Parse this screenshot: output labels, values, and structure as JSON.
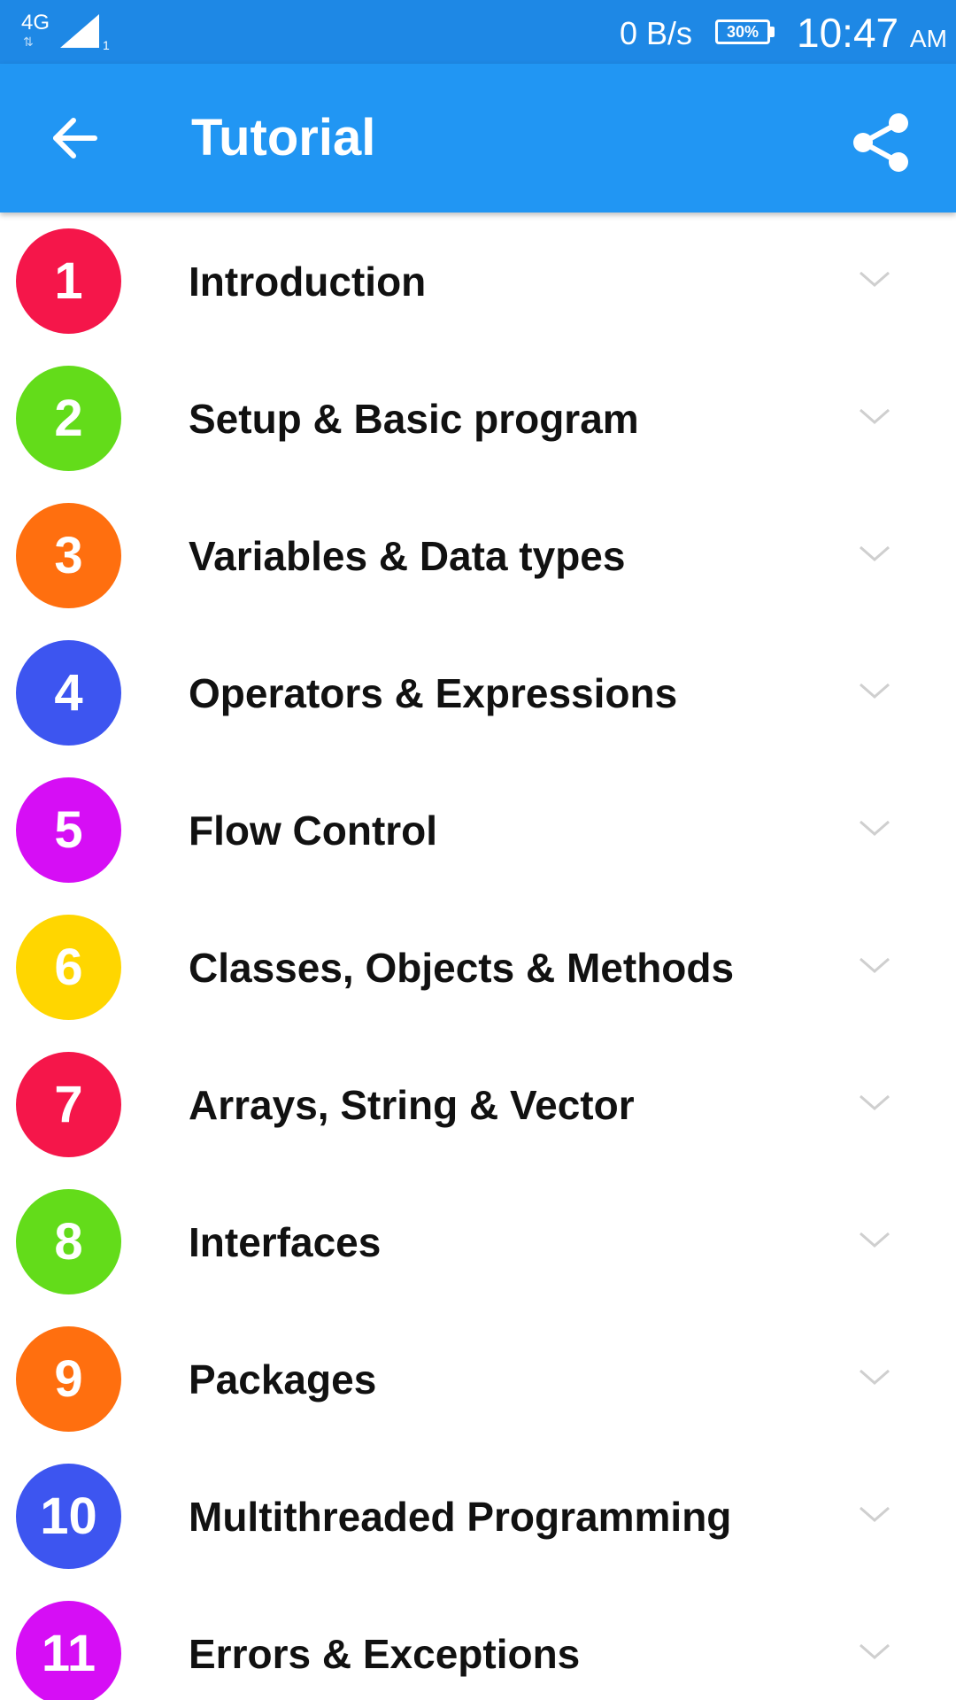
{
  "status_bar": {
    "network": "4G",
    "network_arrows": "⇅",
    "sim": "1",
    "speed": "0 B/s",
    "battery": "30%",
    "time": "10:47",
    "ampm": "AM"
  },
  "app_bar": {
    "title": "Tutorial",
    "back_icon": "arrow-back-icon",
    "share_icon": "share-icon"
  },
  "colors": {
    "status_bar": "#1e88e5",
    "app_bar": "#2196f3",
    "red": "#f5164a",
    "green": "#63dc1a",
    "orange": "#ff6f0f",
    "blue": "#3d55f0",
    "magenta": "#d60ef5",
    "yellow": "#ffd600"
  },
  "items": [
    {
      "number": "1",
      "label": "Introduction",
      "color": "#f5164a"
    },
    {
      "number": "2",
      "label": "Setup & Basic program",
      "color": "#63dc1a"
    },
    {
      "number": "3",
      "label": "Variables & Data types",
      "color": "#ff6f0f"
    },
    {
      "number": "4",
      "label": "Operators & Expressions",
      "color": "#3d55f0"
    },
    {
      "number": "5",
      "label": "Flow Control",
      "color": "#d60ef5"
    },
    {
      "number": "6",
      "label": "Classes, Objects & Methods",
      "color": "#ffd600"
    },
    {
      "number": "7",
      "label": "Arrays, String & Vector",
      "color": "#f5164a"
    },
    {
      "number": "8",
      "label": "Interfaces",
      "color": "#63dc1a"
    },
    {
      "number": "9",
      "label": "Packages",
      "color": "#ff6f0f"
    },
    {
      "number": "10",
      "label": "Multithreaded Programming",
      "color": "#3d55f0"
    },
    {
      "number": "11",
      "label": "Errors & Exceptions",
      "color": "#d60ef5"
    }
  ]
}
